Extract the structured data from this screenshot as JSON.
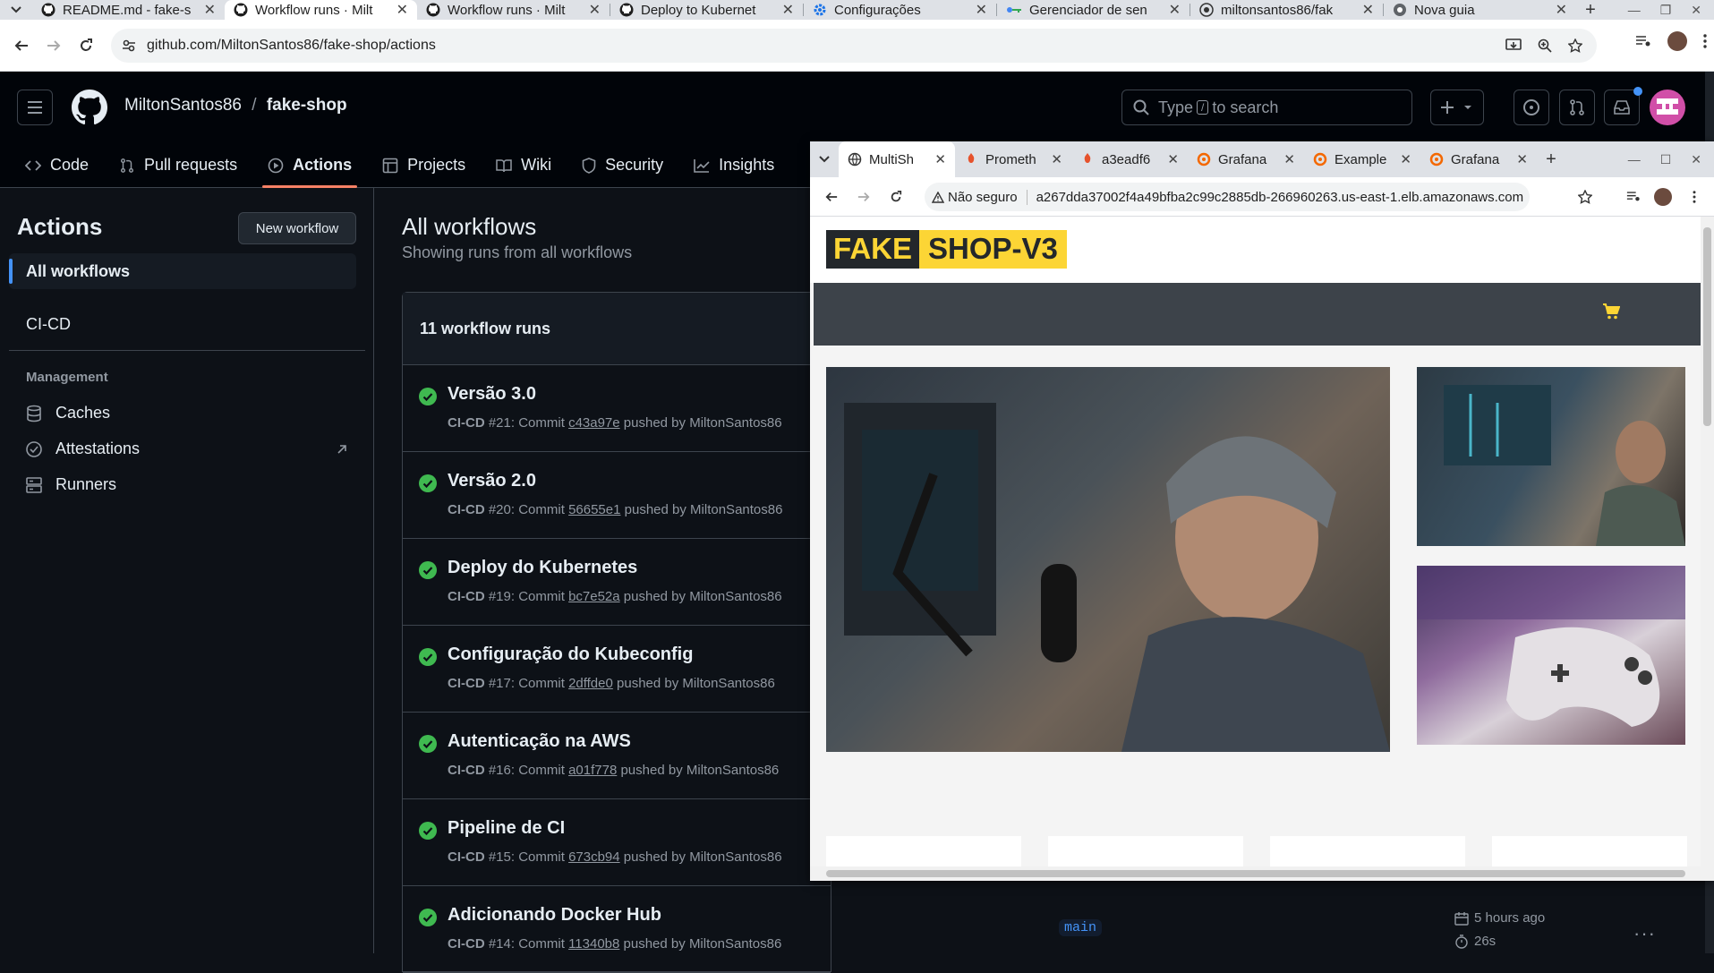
{
  "chrome": {
    "tabs": [
      {
        "label": "README.md - fake-s",
        "icon": "github-icon",
        "active": false
      },
      {
        "label": "Workflow runs · Milt",
        "icon": "github-icon",
        "active": true
      },
      {
        "label": "Workflow runs · Milt",
        "icon": "github-icon",
        "active": false
      },
      {
        "label": "Deploy to Kubernet",
        "icon": "github-icon",
        "active": false
      },
      {
        "label": "Configurações",
        "icon": "gear-icon",
        "active": false
      },
      {
        "label": "Gerenciador de sen",
        "icon": "key-icon",
        "active": false
      },
      {
        "label": "miltonsantos86/fak",
        "icon": "docker-icon",
        "active": false
      },
      {
        "label": "Nova guia",
        "icon": "chrome-icon",
        "active": false
      }
    ],
    "url": "github.com/MiltonSantos86/fake-shop/actions"
  },
  "github": {
    "owner": "MiltonSantos86",
    "separator": "/",
    "repo": "fake-shop",
    "search_text_before": "Type",
    "search_key": "/",
    "search_text_after": "to search",
    "nav": [
      {
        "label": "Code",
        "icon": "code-icon",
        "active": false
      },
      {
        "label": "Pull requests",
        "icon": "pull-request-icon",
        "active": false
      },
      {
        "label": "Actions",
        "icon": "play-icon",
        "active": true
      },
      {
        "label": "Projects",
        "icon": "table-icon",
        "active": false
      },
      {
        "label": "Wiki",
        "icon": "book-icon",
        "active": false
      },
      {
        "label": "Security",
        "icon": "shield-icon",
        "active": false
      },
      {
        "label": "Insights",
        "icon": "graph-icon",
        "active": false
      }
    ],
    "sidebar": {
      "title": "Actions",
      "new_workflow": "New workflow",
      "all_workflows": "All workflows",
      "workflow": "CI-CD",
      "management_title": "Management",
      "management": [
        {
          "label": "Caches",
          "icon": "database-icon"
        },
        {
          "label": "Attestations",
          "icon": "verified-icon"
        },
        {
          "label": "Runners",
          "icon": "server-icon"
        }
      ]
    },
    "main": {
      "title": "All workflows",
      "subtitle": "Showing runs from all workflows",
      "count": "11 workflow runs",
      "runs": [
        {
          "title": "Versão 3.0",
          "wf": "CI-CD",
          "num": "#21",
          "commit": "c43a97e",
          "by": "MiltonSantos86"
        },
        {
          "title": "Versão 2.0",
          "wf": "CI-CD",
          "num": "#20",
          "commit": "56655e1",
          "by": "MiltonSantos86"
        },
        {
          "title": "Deploy do Kubernetes",
          "wf": "CI-CD",
          "num": "#19",
          "commit": "bc7e52a",
          "by": "MiltonSantos86"
        },
        {
          "title": "Configuração do Kubeconfig",
          "wf": "CI-CD",
          "num": "#17",
          "commit": "2dffde0",
          "by": "MiltonSantos86"
        },
        {
          "title": "Autenticação na AWS",
          "wf": "CI-CD",
          "num": "#16",
          "commit": "a01f778",
          "by": "MiltonSantos86"
        },
        {
          "title": "Pipeline de CI",
          "wf": "CI-CD",
          "num": "#15",
          "commit": "673cb94",
          "by": "MiltonSantos86"
        },
        {
          "title": "Adicionando Docker Hub",
          "wf": "CI-CD",
          "num": "#14",
          "commit": "11340b8",
          "by": "MiltonSantos86"
        }
      ],
      "commit_word": "Commit",
      "pushed_by": "pushed by",
      "last_branch": "main",
      "last_time": "5 hours ago",
      "last_duration": "26s"
    }
  },
  "overlay": {
    "tabs": [
      {
        "label": "MultiSh",
        "icon": "globe-icon",
        "active": true
      },
      {
        "label": "Prometh",
        "icon": "prometheus-icon",
        "active": false
      },
      {
        "label": "a3eadf6",
        "icon": "prometheus-icon",
        "active": false
      },
      {
        "label": "Grafana",
        "icon": "grafana-icon",
        "active": false
      },
      {
        "label": "Example",
        "icon": "grafana-icon",
        "active": false
      },
      {
        "label": "Grafana",
        "icon": "grafana-icon",
        "active": false
      }
    ],
    "security": "Não seguro",
    "url": "a267dda37002f4a49bfba2c99c2885db-266960263.us-east-1.elb.amazonaws.com",
    "logo_a": "FAKE",
    "logo_b": "SHOP-V3",
    "carousel_active": 1,
    "carousel_count": 3
  },
  "colors": {
    "accent": "#f78166",
    "success": "#3fb950",
    "link": "#4493f8",
    "brand_yellow": "#fcd535"
  }
}
